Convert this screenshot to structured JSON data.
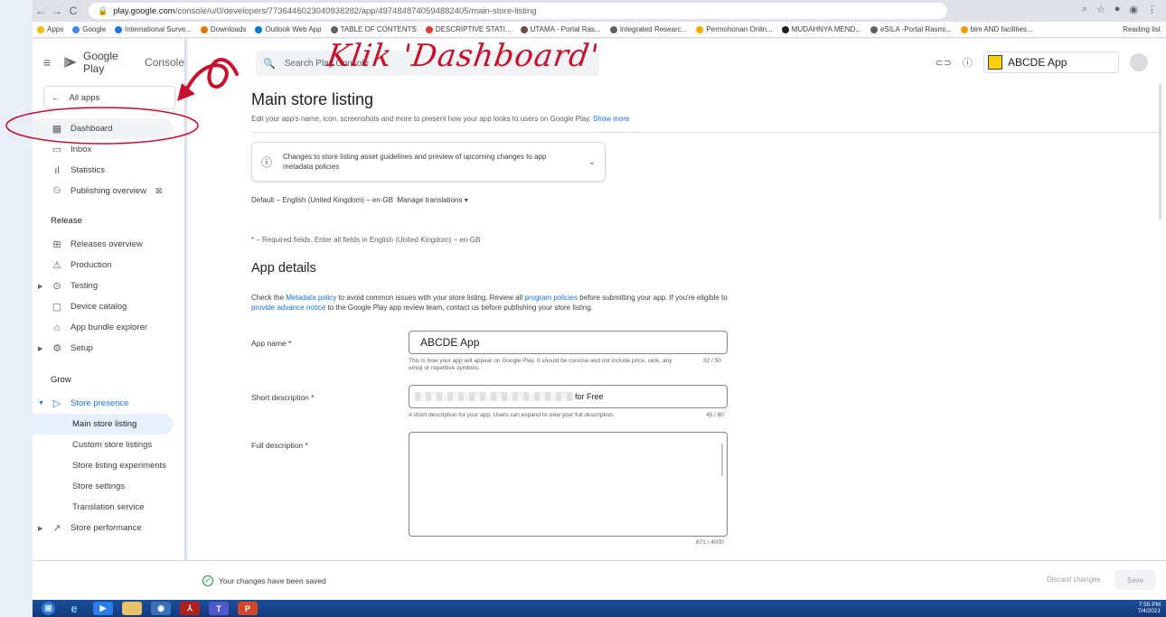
{
  "browser": {
    "url_host": "play.google.com",
    "url_path": "/console/u/0/developers/7736446023040938282/app/4974848740594882405/main-store-listing",
    "bookmarks": [
      "Apps",
      "Google",
      "International Surve...",
      "Downloads",
      "Outlook Web App",
      "TABLE OF CONTENTS",
      "DESCRIPTIVE STATI...",
      "UTAMA - Portal Ras...",
      "Integrated Researc...",
      "Permohonan Onlin...",
      "MUDAHNYA MEND...",
      "eSILA -Portal Rasmi...",
      "bim AND facilities..."
    ],
    "reading_list": "Reading list"
  },
  "console": {
    "brand": "Google Play",
    "brand_suffix": "Console",
    "search_placeholder": "Search Play Console",
    "app_name": "ABCDE App"
  },
  "sidebar": {
    "all_apps": "All apps",
    "items": [
      {
        "label": "Dashboard",
        "icon": "dashboard-icon"
      },
      {
        "label": "Inbox",
        "icon": "inbox-icon"
      },
      {
        "label": "Statistics",
        "icon": "bar-chart-icon"
      },
      {
        "label": "Publishing overview",
        "icon": "publishing-icon"
      }
    ],
    "release_header": "Release",
    "release_items": [
      {
        "label": "Releases overview"
      },
      {
        "label": "Production"
      },
      {
        "label": "Testing"
      },
      {
        "label": "Device catalog"
      },
      {
        "label": "App bundle explorer"
      },
      {
        "label": "Setup"
      }
    ],
    "grow_header": "Grow",
    "store_presence": "Store presence",
    "store_sub": [
      "Main store listing",
      "Custom store listings",
      "Store listing experiments",
      "Store settings",
      "Translation service"
    ],
    "store_performance": "Store performance"
  },
  "page": {
    "title": "Main store listing",
    "subtitle": "Edit your app's name, icon, screenshots and more to present how your app looks to users on Google Play.",
    "show_more": "Show more",
    "notice": "Changes to store listing asset guidelines and preview of upcoming changes to app metadata policies",
    "language": "Default – English (United Kingdom) – en-GB",
    "manage_translations": "Manage translations",
    "required_note": "* – Required fields. Enter all fields in English (United Kingdom) – en-GB",
    "section_title": "App details",
    "para_1": "Check the ",
    "para_link1": "Metadata policy",
    "para_2": " to avoid common issues with your store listing. Review all ",
    "para_link2": "program policies",
    "para_3": " before submitting your app. If you're eligible to ",
    "para_link3": "provide advance notice",
    "para_4": " to the Google Play app review team, contact us before publishing your store listing.",
    "app_name_label": "App name  *",
    "app_name_value": "ABCDE App",
    "app_name_help": "This is how your app will appear on Google Play. It should be concise and not include price, rank, any emoji or repetitive symbols.",
    "app_name_count": "32 / 50",
    "short_desc_label": "Short description  *",
    "short_desc_value": "for Free",
    "short_desc_help": "A short description for your app. Users can expand to view your full description.",
    "short_desc_count": "45 / 80",
    "full_desc_label": "Full description  *",
    "full_desc_count": "871 / 4000"
  },
  "footer": {
    "saved": "Your changes have been saved",
    "discard": "Discard changes",
    "save": "Save"
  },
  "taskbar": {
    "time": "7:55 PM",
    "date": "7/4/2021"
  },
  "annotation": {
    "text": "Klik 'Dashboard'",
    "color": "#c8102e"
  }
}
